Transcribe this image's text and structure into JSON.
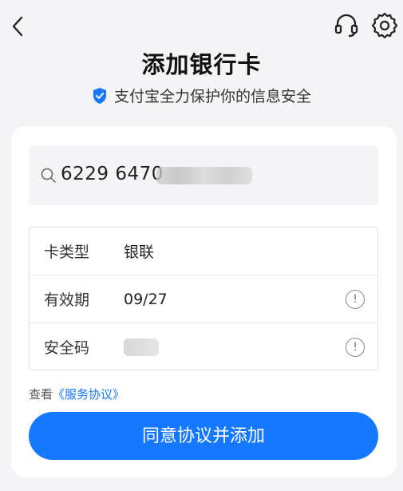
{
  "header": {
    "title": "添加银行卡",
    "subtitle": "支付宝全力保护你的信息安全"
  },
  "card_search": {
    "card_number_visible": "6229 6470"
  },
  "info": {
    "card_type_label": "卡类型",
    "card_type_value": "银联",
    "expiry_label": "有效期",
    "expiry_value": "09/27",
    "cvv_label": "安全码",
    "tip_icon_char": "!"
  },
  "agreement": {
    "prefix": "查看",
    "link": "《服务协议》"
  },
  "submit_label": "同意协议并添加",
  "colors": {
    "accent": "#1677ff",
    "background": "#f4f4f6",
    "card": "#ffffff"
  },
  "icons": [
    "back-arrow-icon",
    "headset-icon",
    "settings-icon",
    "shield-check-icon",
    "search-icon",
    "info-icon"
  ]
}
